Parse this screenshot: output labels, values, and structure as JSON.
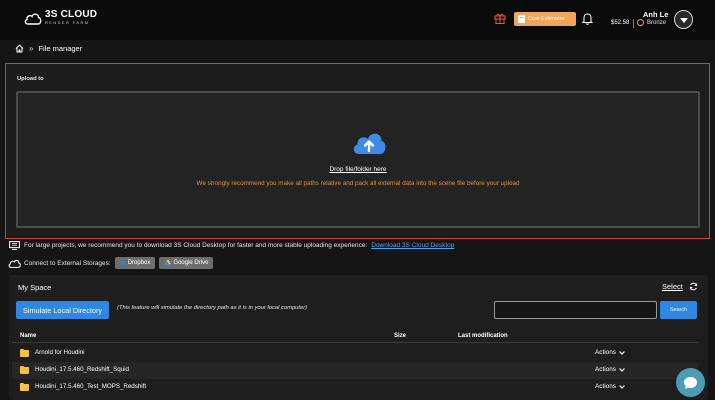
{
  "header": {
    "logo_main": "3S CLOUD",
    "logo_sub": "RENDER FARM",
    "cost_estimator_label": "Cost Estimator",
    "user_name": "Anh Le",
    "balance": "$52.58",
    "tier": "Bronze"
  },
  "breadcrumb": {
    "current": "File manager",
    "separator": "»"
  },
  "upload": {
    "label": "Upload to",
    "drop_text": "Drop file/folder here",
    "hint": "We strongly recommend you make all paths relative and pack all external data into the scene file before your upload"
  },
  "desktop": {
    "text": "For large projects, we recommend you to download 3S Cloud Desktop for faster and more stable uploading experience:",
    "link": "Download 3S Cloud Desktop"
  },
  "external": {
    "label": "Connect to External Storages:",
    "dropbox": "Dropbox",
    "gdrive": "Google Drive"
  },
  "myspace": {
    "title": "My Space",
    "select_label": "Select",
    "simulate_label": "Simulate Local Directory",
    "simulate_note": "(This feature will simulate the directory path as it is in your local computer)",
    "search_value": "",
    "search_label": "Search",
    "columns": {
      "name": "Name",
      "size": "Size",
      "modified": "Last modification"
    },
    "rows": [
      {
        "name": "Arnold for Houdini",
        "actions": "Actions"
      },
      {
        "name": "Houdini_17.5.460_Redshift_Squid",
        "actions": "Actions"
      },
      {
        "name": "Houdini_17.5.460_Test_MOPS_Redshift",
        "actions": "Actions"
      }
    ]
  },
  "colors": {
    "accent_blue": "#2f87e4",
    "cost_orange": "#f0a55a",
    "hint_orange": "#e3913f",
    "upload_border_red": "#d6402f",
    "folder_yellow": "#f5c044"
  }
}
